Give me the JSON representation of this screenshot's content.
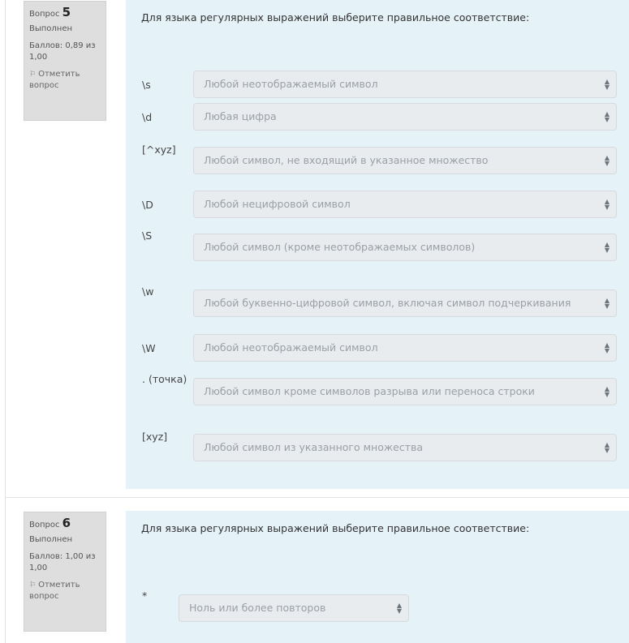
{
  "questions": [
    {
      "number_label": "Вопрос",
      "number": "5",
      "state": "Выполнен",
      "grade": "Баллов: 0,89 из 1,00",
      "flag_label": "Отметить вопрос",
      "text": "Для языка регулярных выражений выберите правильное соответствие:",
      "items": [
        {
          "term": "\\s",
          "answer": "Любой неотображаемый символ"
        },
        {
          "term": "\\d",
          "answer": "Любая цифра"
        },
        {
          "term": "[^xyz]",
          "answer": "Любой символ, не входящий в указанное множество"
        },
        {
          "term": "\\D",
          "answer": "Любой нецифровой символ"
        },
        {
          "term": "\\S",
          "answer": "Любой символ (кроме неотображаемых символов)"
        },
        {
          "term": "\\w",
          "answer": "Любой буквенно-цифровой символ, включая символ подчеркивания"
        },
        {
          "term": "\\W",
          "answer": "Любой неотображаемый символ"
        },
        {
          "term": ". (точка)",
          "answer": "Любой символ кроме символов разрыва или переноса строки"
        },
        {
          "term": "[xyz]",
          "answer": "Любой символ из указанного множества"
        }
      ]
    },
    {
      "number_label": "Вопрос",
      "number": "6",
      "state": "Выполнен",
      "grade": "Баллов: 1,00 из 1,00",
      "flag_label": "Отметить вопрос",
      "text": "Для языка регулярных выражений выберите правильное соответствие:",
      "items": [
        {
          "term": "*",
          "answer": "Ноль или более повторов"
        }
      ]
    }
  ],
  "icons": {
    "flag": "flag-icon",
    "select_caret": "select-caret-icon"
  },
  "colors": {
    "panel_bg": "#e5f2f8",
    "info_bg": "#dedede",
    "select_bg": "#e9ecef",
    "select_text": "#9aa0a6"
  }
}
